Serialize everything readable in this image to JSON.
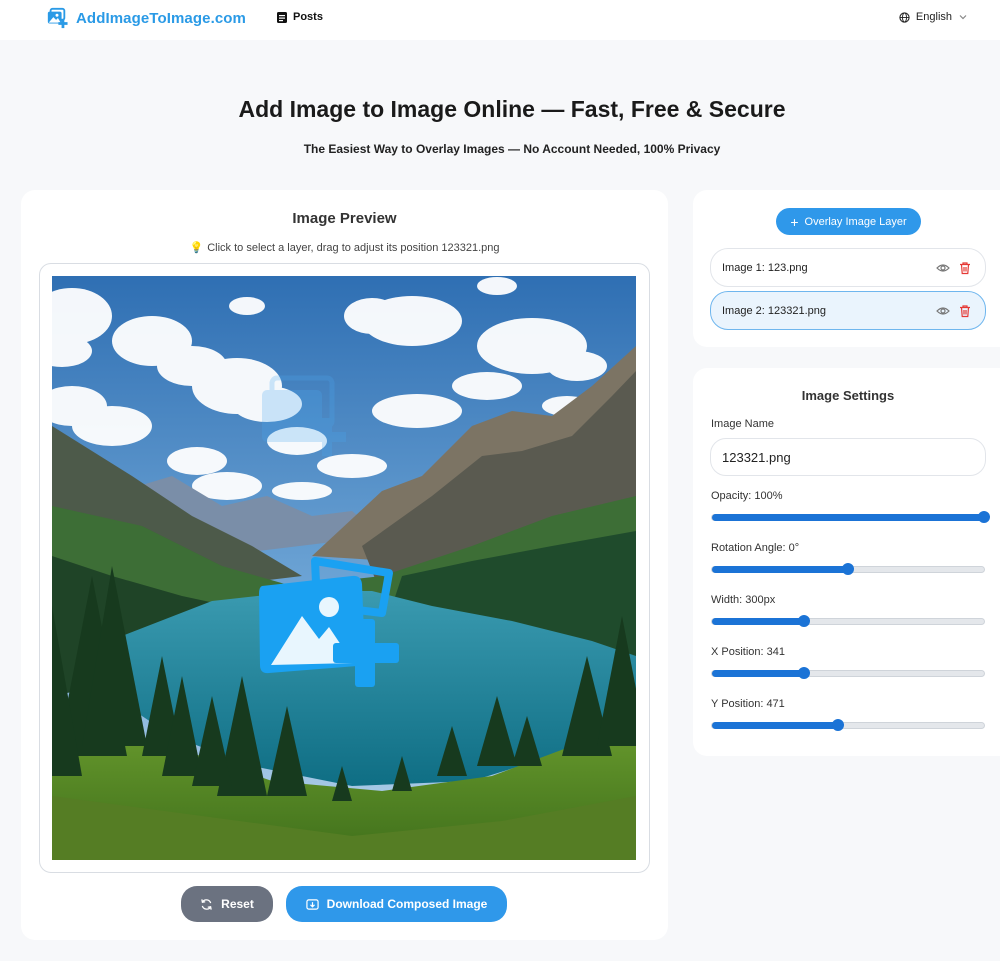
{
  "header": {
    "brand": "AddImageToImage.com",
    "posts_label": "Posts",
    "language": "English"
  },
  "hero": {
    "title": "Add Image to Image Online — Fast, Free & Secure",
    "subtitle": "The Easiest Way to Overlay Images — No Account Needed, 100% Privacy"
  },
  "preview": {
    "title": "Image Preview",
    "hint": "Click to select a layer, drag to adjust its position 123321.png",
    "reset_label": "Reset",
    "download_label": "Download Composed Image"
  },
  "layers": {
    "add_label": "Overlay Image Layer",
    "items": [
      {
        "label": "Image 1: 123.png",
        "active": false
      },
      {
        "label": "Image 2: 123321.png",
        "active": true
      }
    ]
  },
  "settings": {
    "title": "Image Settings",
    "name_label": "Image Name",
    "name_value": "123321.png",
    "opacity_label": "Opacity: 100%",
    "opacity_value": 1.0,
    "rotation_label": "Rotation Angle: 0°",
    "rotation_value": 0.5,
    "width_label": "Width: 300px",
    "width_value": 0.34,
    "x_label": "X Position: 341",
    "x_value": 0.34,
    "y_label": "Y Position: 471",
    "y_value": 0.465
  },
  "colors": {
    "accent": "#2f98ea",
    "slider": "#1b73d6",
    "reset": "#6b7280"
  }
}
